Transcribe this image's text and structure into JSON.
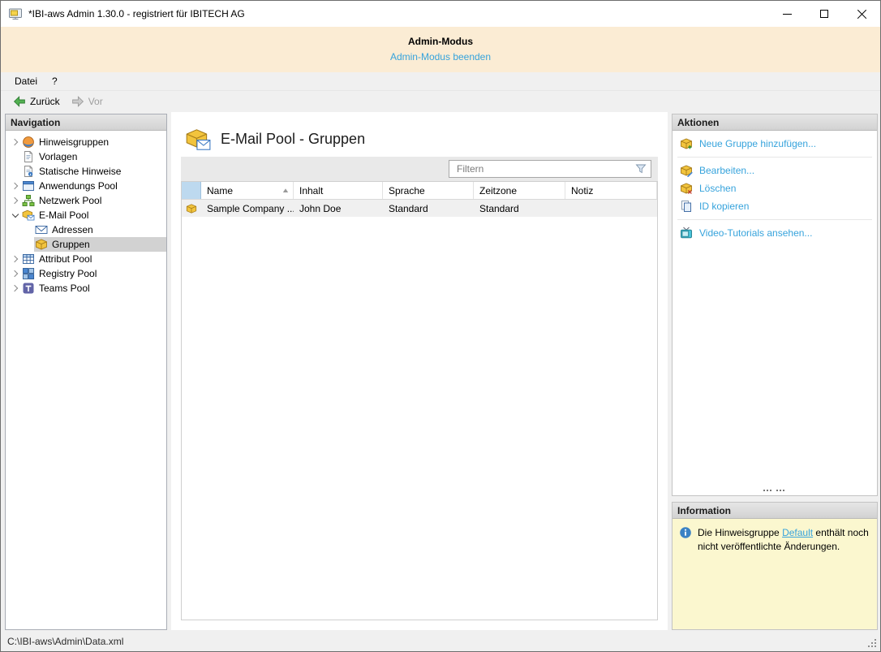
{
  "colors": {
    "accent_blue": "#36a3dc",
    "banner_bg": "#fbecd4",
    "info_bg": "#fbf7cf",
    "selection": "#d2d2d2"
  },
  "window": {
    "title": "*IBI-aws Admin 1.30.0 - registriert für IBITECH AG"
  },
  "banner": {
    "title": "Admin-Modus",
    "link": "Admin-Modus beenden"
  },
  "menu": {
    "items": [
      {
        "label": "Datei"
      },
      {
        "label": "?"
      }
    ]
  },
  "toolbar": {
    "back": "Zurück",
    "forward": "Vor"
  },
  "navigation": {
    "header": "Navigation",
    "items": [
      {
        "label": "Hinweisgruppen",
        "icon": "hint-groups-icon",
        "level": 0,
        "expander": "collapsed",
        "selected": false
      },
      {
        "label": "Vorlagen",
        "icon": "templates-icon",
        "level": 0,
        "expander": "none",
        "selected": false
      },
      {
        "label": "Statische Hinweise",
        "icon": "static-hints-icon",
        "level": 0,
        "expander": "none",
        "selected": false
      },
      {
        "label": "Anwendungs Pool",
        "icon": "application-pool-icon",
        "level": 0,
        "expander": "collapsed",
        "selected": false
      },
      {
        "label": "Netzwerk Pool",
        "icon": "network-pool-icon",
        "level": 0,
        "expander": "collapsed",
        "selected": false
      },
      {
        "label": "E-Mail Pool",
        "icon": "email-pool-icon",
        "level": 0,
        "expander": "expanded",
        "selected": false
      },
      {
        "label": "Adressen",
        "icon": "envelope-icon",
        "level": 1,
        "expander": "none",
        "selected": false
      },
      {
        "label": "Gruppen",
        "icon": "package-icon",
        "level": 1,
        "expander": "none",
        "selected": true
      },
      {
        "label": "Attribut Pool",
        "icon": "attribute-pool-icon",
        "level": 0,
        "expander": "collapsed",
        "selected": false
      },
      {
        "label": "Registry Pool",
        "icon": "registry-pool-icon",
        "level": 0,
        "expander": "collapsed",
        "selected": false
      },
      {
        "label": "Teams Pool",
        "icon": "teams-pool-icon",
        "level": 0,
        "expander": "collapsed",
        "selected": false
      }
    ]
  },
  "main": {
    "title": "E-Mail Pool - Gruppen",
    "title_icon": "email-pool-large-icon",
    "filter_placeholder": "Filtern",
    "table": {
      "columns": [
        "Name",
        "Inhalt",
        "Sprache",
        "Zeitzone",
        "Notiz"
      ],
      "sort": {
        "column": "Name",
        "direction": "asc"
      },
      "rows": [
        {
          "icon": "package-icon",
          "cells": [
            "Sample Company ...",
            "John Doe",
            "Standard",
            "Standard",
            ""
          ]
        }
      ]
    }
  },
  "actions": {
    "header": "Aktionen",
    "groups": [
      [
        {
          "label": "Neue Gruppe hinzufügen...",
          "icon": "package-add-icon"
        }
      ],
      [
        {
          "label": "Bearbeiten...",
          "icon": "package-edit-icon"
        },
        {
          "label": "Löschen",
          "icon": "package-delete-icon"
        },
        {
          "label": "ID kopieren",
          "icon": "copy-icon"
        }
      ],
      [
        {
          "label": "Video-Tutorials ansehen...",
          "icon": "video-icon"
        }
      ]
    ]
  },
  "information": {
    "header": "Information",
    "text_before": "Die Hinweisgruppe ",
    "link_label": "Default",
    "text_after": " enthält noch nicht veröffentlichte Änderungen."
  },
  "statusbar": {
    "path": "C:\\IBI-aws\\Admin\\Data.xml"
  }
}
